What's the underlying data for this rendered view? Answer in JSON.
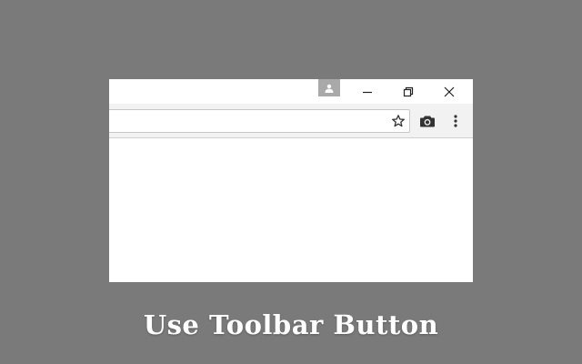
{
  "caption": {
    "text": "Use Toolbar Button"
  },
  "window": {
    "controls": {
      "profile_icon": "person-icon",
      "minimize_icon": "minimize-icon",
      "restore_icon": "restore-icon",
      "close_icon": "close-icon"
    }
  },
  "toolbar": {
    "address_value": "",
    "bookmark_icon": "star-icon",
    "extension_icon": "camera-icon",
    "menu_icon": "kebab-menu-icon"
  },
  "colors": {
    "background": "#7a7a7a",
    "window": "#ffffff",
    "toolbar": "#f2f2f2",
    "profile_badge": "#a9a9a9",
    "icon": "#333333",
    "caption": "#ffffff"
  }
}
